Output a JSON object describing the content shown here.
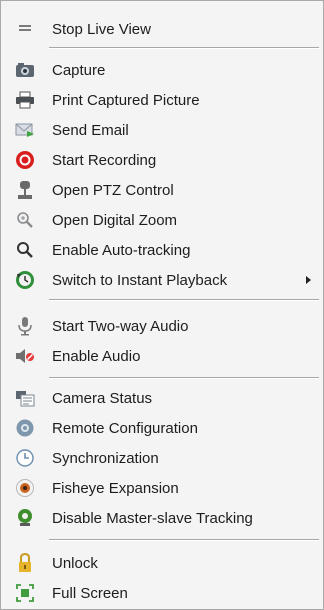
{
  "menu": {
    "items": [
      {
        "label": "Stop Live View",
        "icon": "stop-live-view-icon"
      },
      {
        "label": "Capture",
        "icon": "camera-icon"
      },
      {
        "label": "Print Captured Picture",
        "icon": "printer-icon"
      },
      {
        "label": "Send Email",
        "icon": "email-icon"
      },
      {
        "label": "Start Recording",
        "icon": "record-icon"
      },
      {
        "label": "Open PTZ Control",
        "icon": "ptz-icon"
      },
      {
        "label": "Open Digital Zoom",
        "icon": "zoom-icon"
      },
      {
        "label": "Enable Auto-tracking",
        "icon": "search-icon"
      },
      {
        "label": "Switch to Instant Playback",
        "icon": "playback-icon"
      },
      {
        "label": "Start Two-way Audio",
        "icon": "microphone-icon"
      },
      {
        "label": "Enable Audio",
        "icon": "speaker-icon"
      },
      {
        "label": "Camera Status",
        "icon": "status-icon"
      },
      {
        "label": "Remote Configuration",
        "icon": "settings-icon"
      },
      {
        "label": "Synchronization",
        "icon": "clock-icon"
      },
      {
        "label": "Fisheye Expansion",
        "icon": "fisheye-icon"
      },
      {
        "label": "Disable Master-slave Tracking",
        "icon": "tracking-icon"
      },
      {
        "label": "Unlock",
        "icon": "lock-icon"
      },
      {
        "label": "Full Screen",
        "icon": "fullscreen-icon"
      }
    ]
  }
}
